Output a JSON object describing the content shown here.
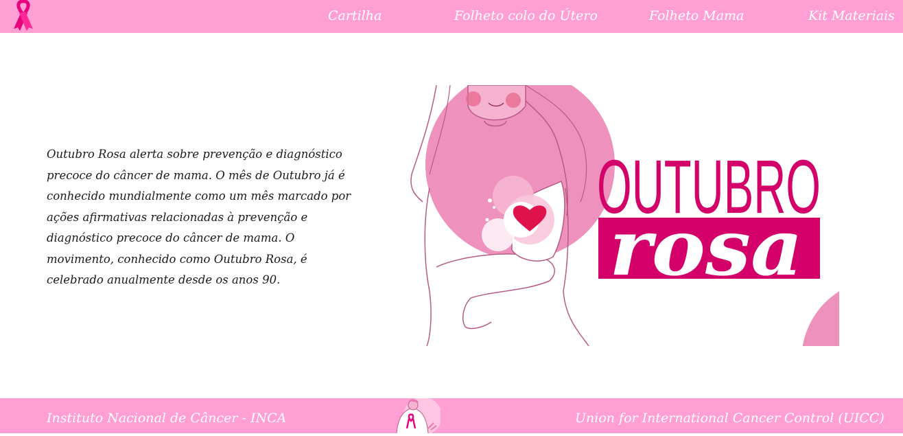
{
  "header": {
    "logo_icon": "pink-ribbon-icon",
    "nav": [
      {
        "label": "Cartilha"
      },
      {
        "label": "Folheto colo do Útero"
      },
      {
        "label": "Folheto Mama"
      },
      {
        "label": "Kit Materiais"
      }
    ]
  },
  "main": {
    "intro_text": "Outubro Rosa alerta sobre prevenção e diagnóstico precoce do câncer de mama. O mês de Outubro já é conhecido mundialmente como um mês marcado por ações afirmativas relacionadas à prevenção e diagnóstico precoce do câncer de mama. O movimento, conhecido como Outubro Rosa, é celebrado anualmente desde os anos 90.",
    "hero": {
      "title_line1": "OUTUBRO",
      "title_line2": "rosa"
    }
  },
  "footer": {
    "left_link": "Instituto Nacional de Câncer - INCA",
    "right_link": "Union for International Cancer Control (UICC)"
  },
  "colors": {
    "header_bg": "#ff9fd4",
    "brand_magenta": "#d4006a",
    "hero_pink": "#ee92bd",
    "text": "#1a1a1a"
  }
}
